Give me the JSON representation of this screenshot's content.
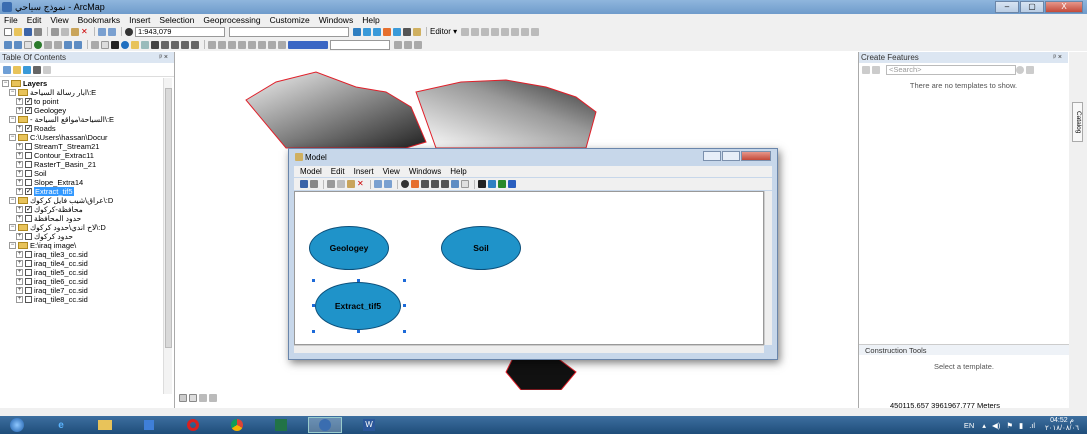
{
  "window": {
    "title": "نموذج سياحي - ArcMap",
    "buttons": [
      "–",
      "▢",
      "X"
    ]
  },
  "menu": [
    "File",
    "Edit",
    "View",
    "Bookmarks",
    "Insert",
    "Selection",
    "Geoprocessing",
    "Customize",
    "Windows",
    "Help"
  ],
  "toolbar": {
    "scale": "1:943,079",
    "editor": "Editor ▾"
  },
  "toc": {
    "title": "Table Of Contents",
    "pin": "ᵖ ×",
    "layers_root": "Layers",
    "items": [
      {
        "label": "ابار رسالة السياحة\\:E",
        "kind": "folder",
        "indent": 1
      },
      {
        "label": "to point",
        "kind": "layer",
        "checked": true,
        "indent": 2
      },
      {
        "label": "Geologey",
        "kind": "layer",
        "checked": true,
        "indent": 2
      },
      {
        "label": "- السياحة\\مواقع السياحة\\:E",
        "kind": "folder",
        "indent": 1
      },
      {
        "label": "Roads",
        "kind": "layer",
        "checked": true,
        "indent": 2
      },
      {
        "label": "C:\\Users\\hassan\\Docur",
        "kind": "folder",
        "indent": 1
      },
      {
        "label": "StreamT_Stream21",
        "kind": "layer",
        "checked": false,
        "indent": 2
      },
      {
        "label": "Contour_Extrac11",
        "kind": "layer",
        "checked": false,
        "indent": 2
      },
      {
        "label": "RasterT_Basin_21",
        "kind": "layer",
        "checked": false,
        "indent": 2
      },
      {
        "label": "Soil",
        "kind": "layer",
        "checked": false,
        "indent": 2
      },
      {
        "label": "Slope_Extra14",
        "kind": "layer",
        "checked": false,
        "indent": 2
      },
      {
        "label": "Extract_tif5",
        "kind": "layer",
        "checked": true,
        "indent": 2,
        "selected": true
      },
      {
        "label": "عراق\\شيب فايل كركوك\\:D",
        "kind": "folder",
        "indent": 1
      },
      {
        "label": "محافظة-كركوك",
        "kind": "layer",
        "checked": true,
        "indent": 2
      },
      {
        "label": "حدود المحافظة",
        "kind": "layer",
        "checked": false,
        "indent": 2
      },
      {
        "label": "لاح اندي\\حدود كركوك\\:D",
        "kind": "folder",
        "indent": 1
      },
      {
        "label": "حدود كركوك",
        "kind": "layer",
        "checked": false,
        "indent": 2
      },
      {
        "label": "E:\\iraq image\\",
        "kind": "folder",
        "indent": 1
      },
      {
        "label": "iraq_tile3_cc.sid",
        "kind": "layer",
        "checked": false,
        "indent": 2
      },
      {
        "label": "iraq_tile4_cc.sid",
        "kind": "layer",
        "checked": false,
        "indent": 2
      },
      {
        "label": "iraq_tile5_cc.sid",
        "kind": "layer",
        "checked": false,
        "indent": 2
      },
      {
        "label": "iraq_tile6_cc.sid",
        "kind": "layer",
        "checked": false,
        "indent": 2
      },
      {
        "label": "iraq_tile7_cc.sid",
        "kind": "layer",
        "checked": false,
        "indent": 2
      },
      {
        "label": "iraq_tile8_cc.sid",
        "kind": "layer",
        "checked": false,
        "indent": 2
      }
    ]
  },
  "create_features": {
    "title": "Create Features",
    "search_placeholder": "<Search>",
    "empty_msg": "There are no templates to show.",
    "construction_title": "Construction Tools",
    "construction_msg": "Select a template."
  },
  "side_tab": "Catalog",
  "status": {
    "coords": "450115.657  3961967.777 Meters"
  },
  "taskbar": {
    "lang": "EN",
    "time": "04:52 م",
    "date": "٢٠١٨/٠٨/٠٦"
  },
  "model": {
    "title": "Model",
    "menu": [
      "Model",
      "Edit",
      "Insert",
      "View",
      "Windows",
      "Help"
    ],
    "nodes": [
      {
        "label": "Geologey",
        "selected": false
      },
      {
        "label": "Soil",
        "selected": false
      },
      {
        "label": "Extract_tif5",
        "selected": true
      }
    ]
  },
  "colors": {
    "node_fill": "#1f93c9",
    "selection": "#3399ff",
    "boundary": "#e0202a"
  }
}
